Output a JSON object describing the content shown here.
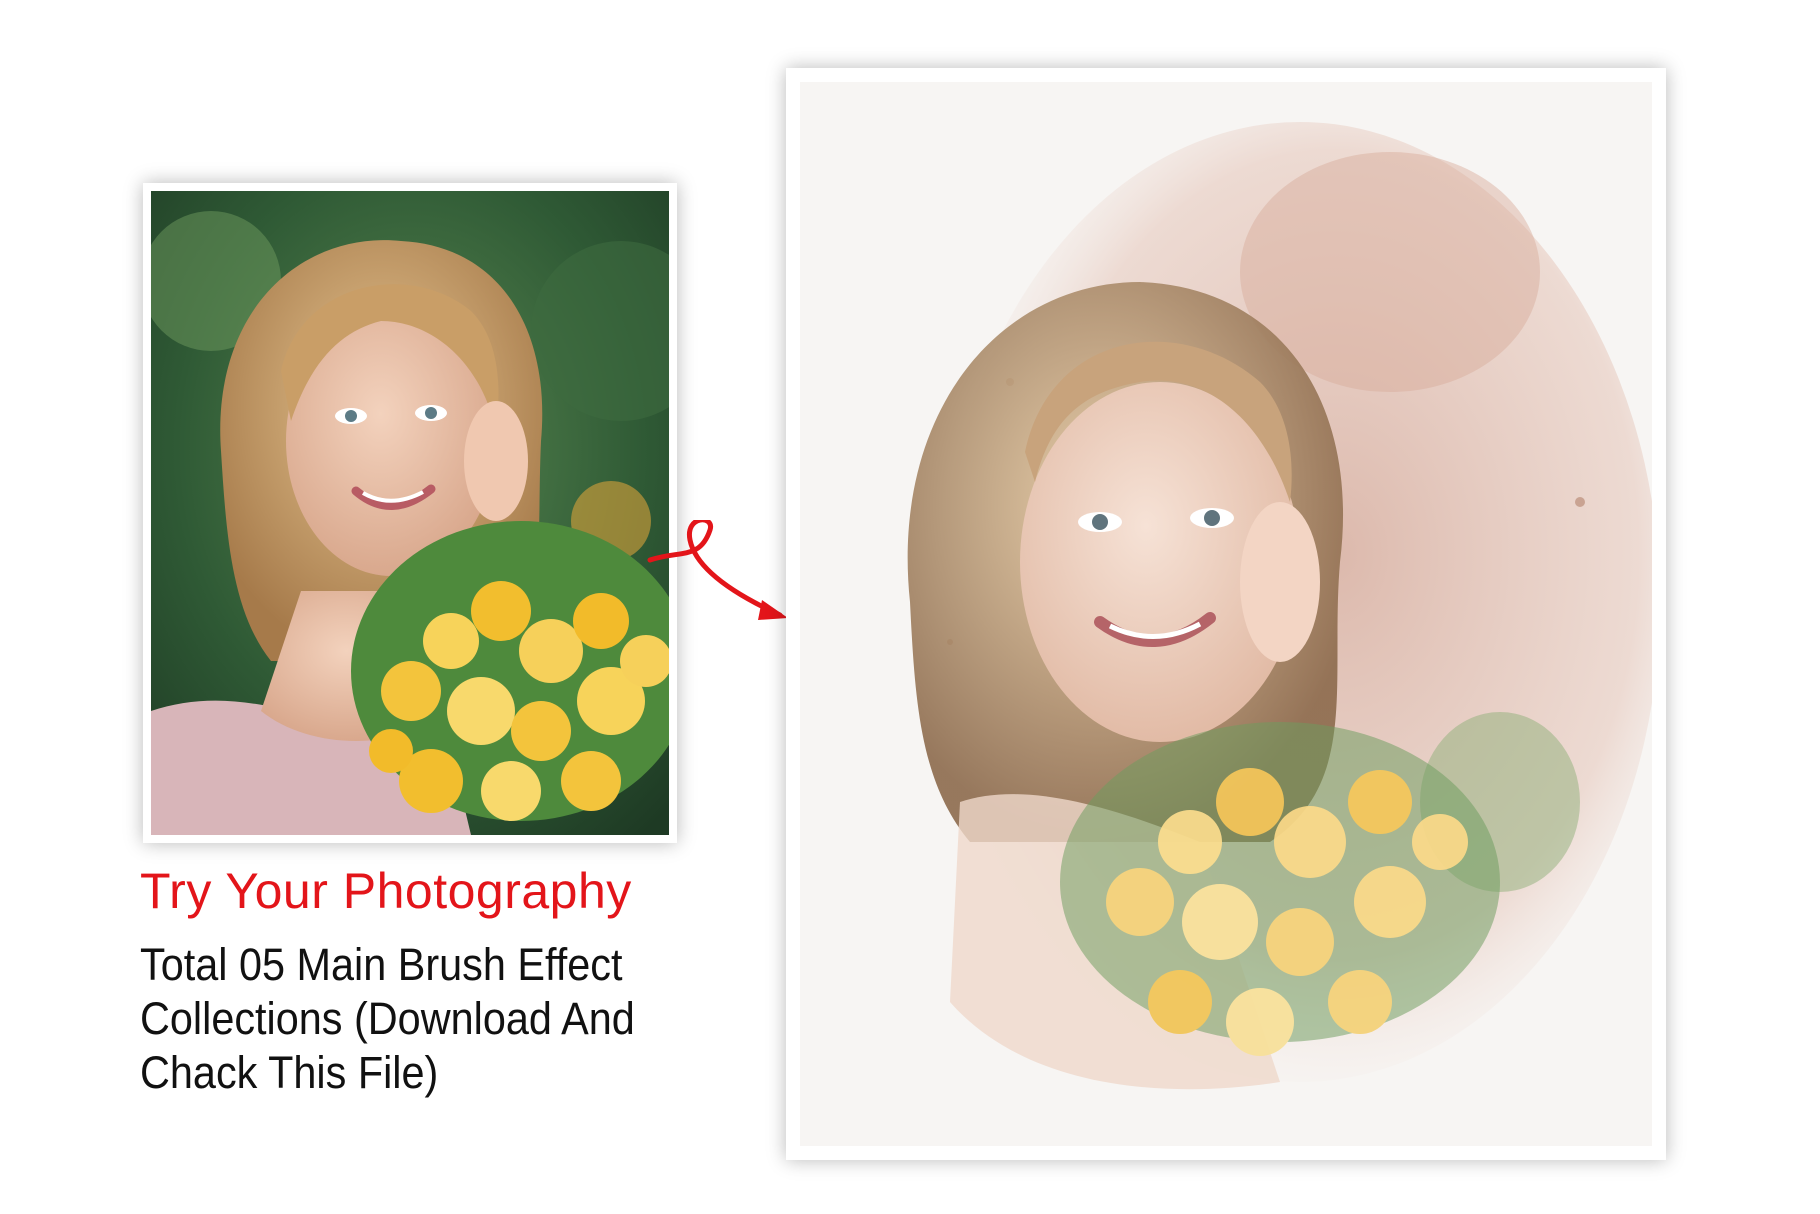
{
  "headline": "Try Your Photography",
  "description": "Total 05 Main Brush Effect Collections (Download And Chack This File)",
  "colors": {
    "headline": "#e3151a",
    "arrow": "#e3151a",
    "description": "#111111",
    "frame": "#ffffff"
  },
  "images": {
    "original": "photo-of-smiling-woman-holding-yellow-flowers",
    "result": "watercolor-painting-of-the-same-woman-with-flowers"
  },
  "icons": {
    "arrow": "curly-arrow-icon"
  }
}
